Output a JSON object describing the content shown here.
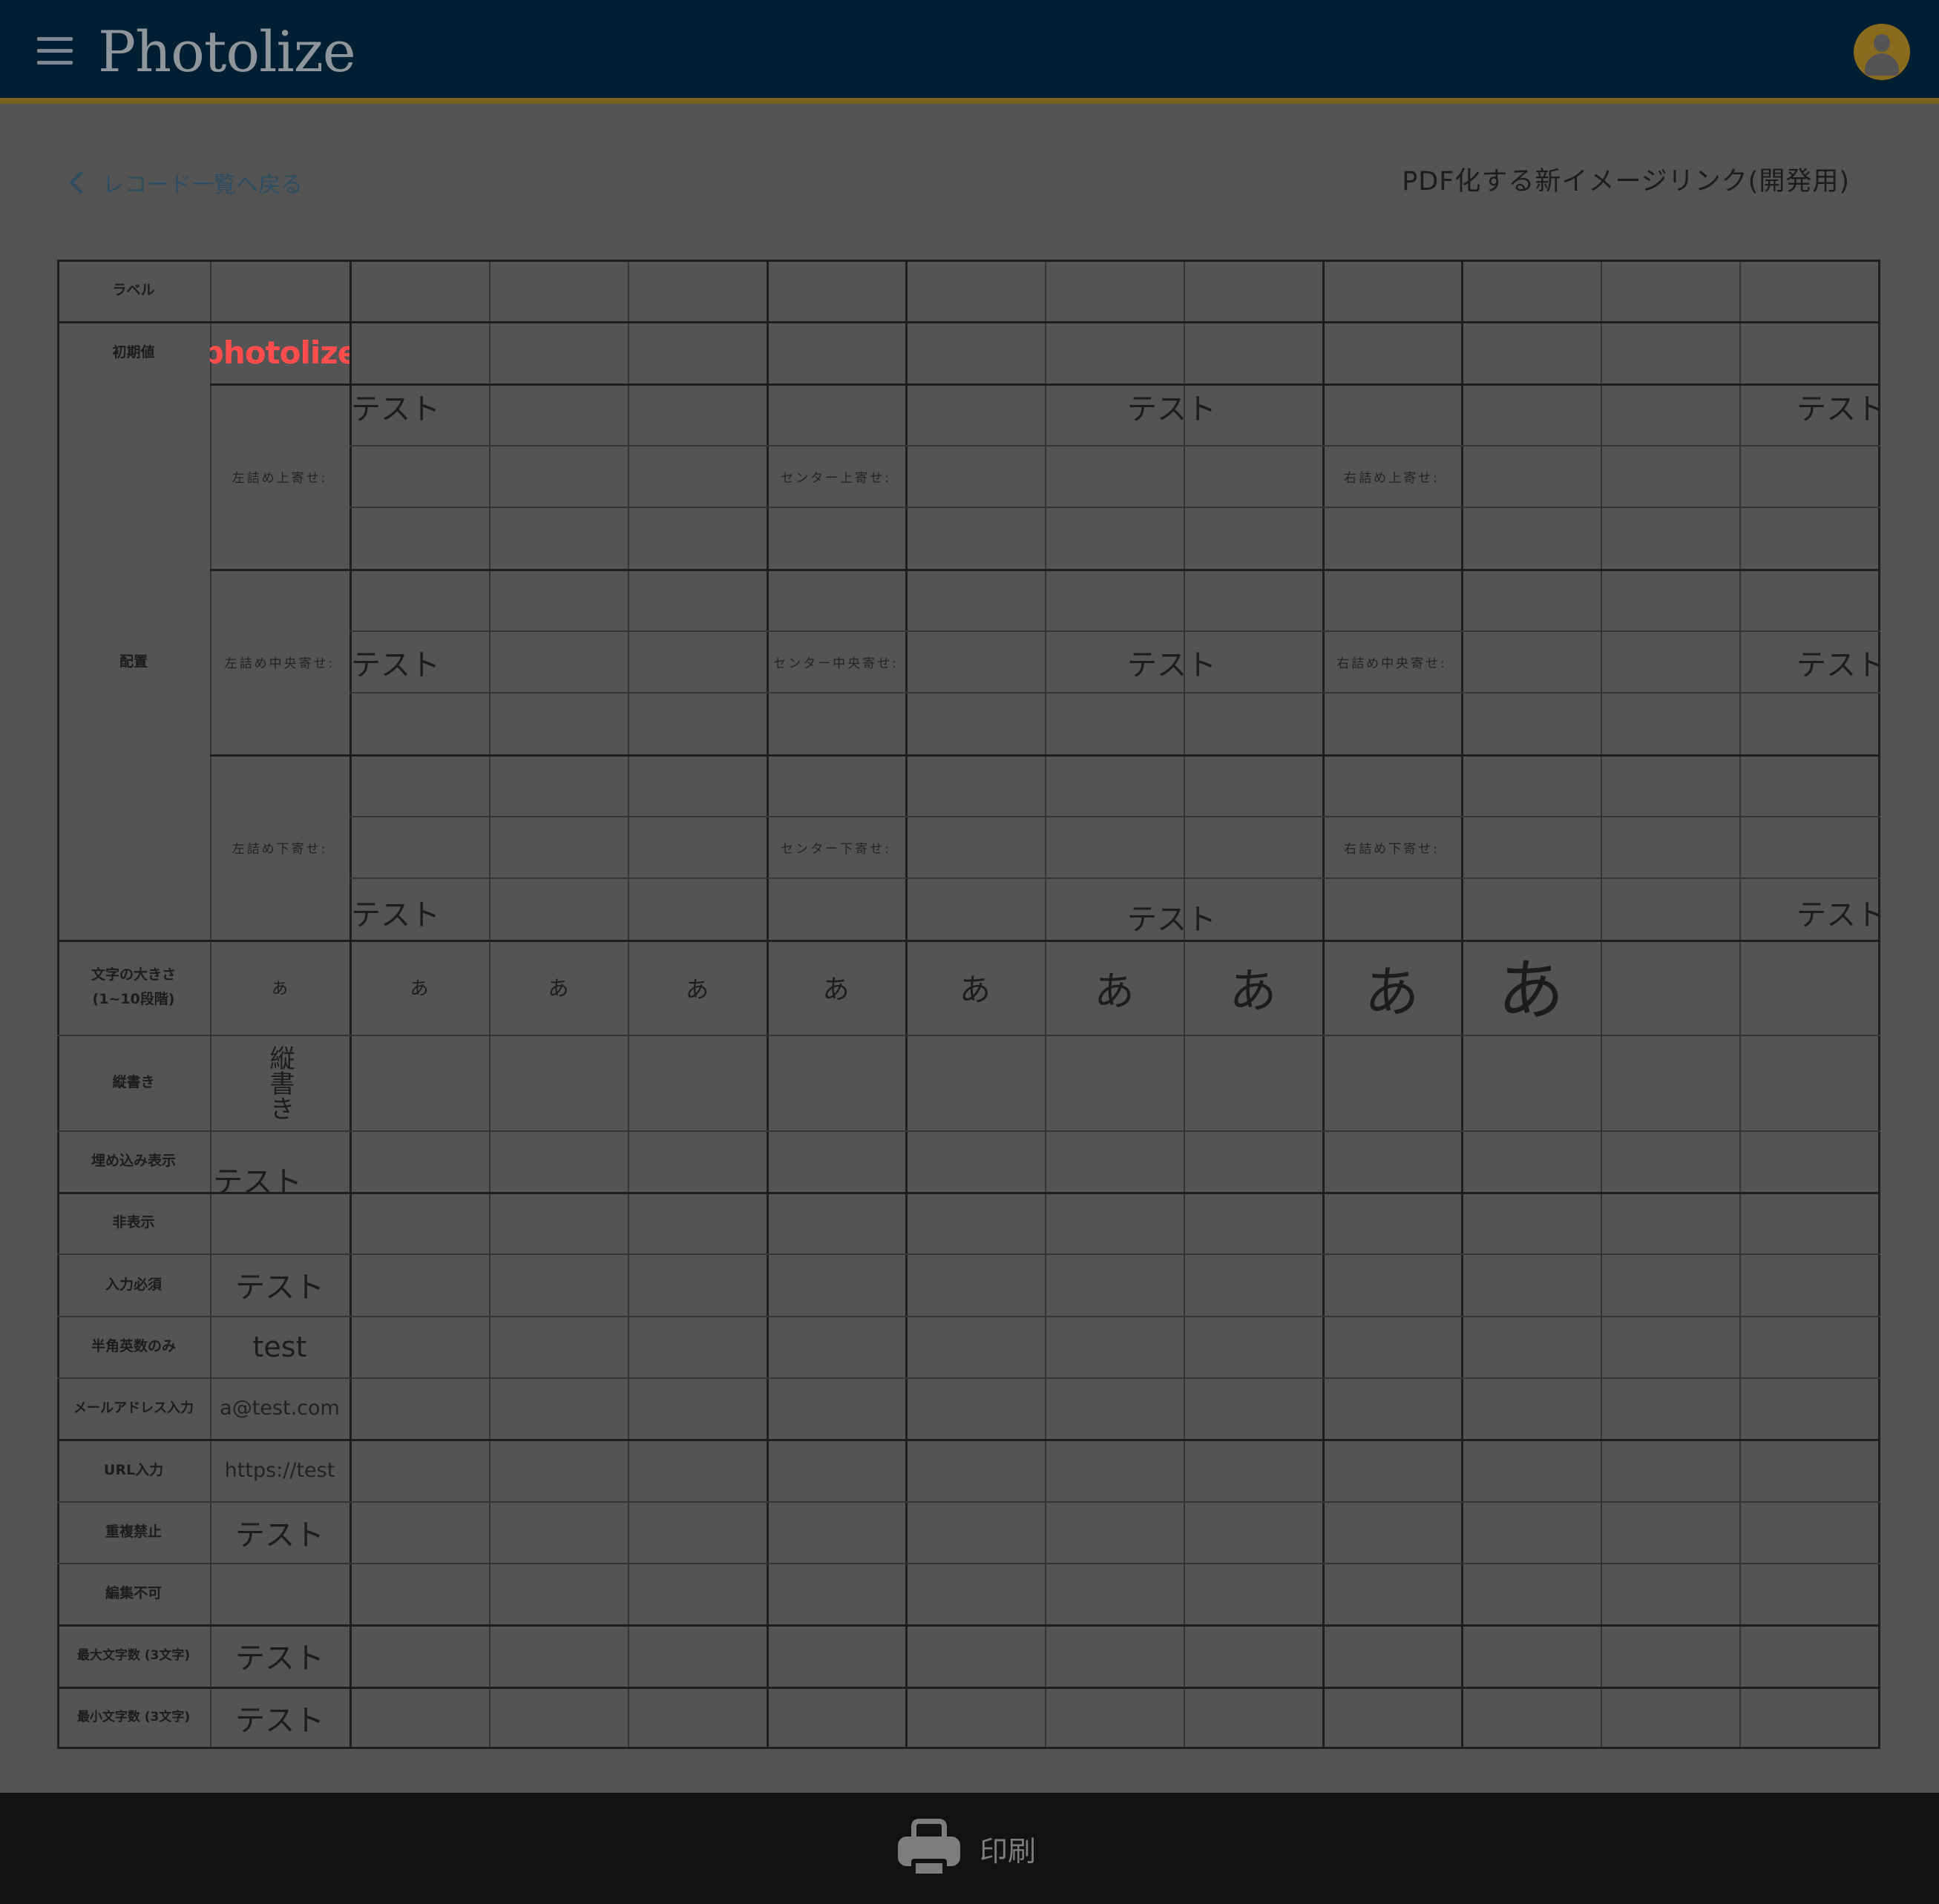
{
  "header": {
    "app_name": "Photolize",
    "menu_icon": "hamburger-icon",
    "avatar_icon": "user-avatar-icon",
    "colors": {
      "bar": "#001f33",
      "accent": "#7a6320",
      "avatar": "#8a6a1c"
    }
  },
  "subbar": {
    "back_label": "レコード一覧へ戻る",
    "back_icon": "chevron-left-icon",
    "title": "PDF化する新イメージリンク(開発用)"
  },
  "grid": {
    "row_labels": {
      "label": "ラベル",
      "initial": "初期値",
      "layout": "配置",
      "font_size": "文字の大きさ\n(1~10段階)",
      "vertical": "縦書き",
      "embed": "埋め込み表示",
      "hidden": "非表示",
      "required": "入力必須",
      "halfwidth": "半角英数のみ",
      "email": "メールアドレス入力",
      "url": "URL入力",
      "no_dup": "重複禁止",
      "no_edit": "編集不可",
      "max_chars": "最大文字数 (3文字)",
      "min_chars": "最小文字数 (3文字)"
    },
    "initial_logo": "photolize",
    "align_labels": {
      "left_top": "左詰め上寄せ:",
      "left_mid": "左詰め中央寄せ:",
      "left_bot": "左詰め下寄せ:",
      "center_top": "センター上寄せ:",
      "center_mid": "センター中央寄せ:",
      "center_bot": "センター下寄せ:",
      "right_top": "右詰め上寄せ:",
      "right_mid": "右詰め中央寄せ:",
      "right_bot": "右詰め下寄せ:"
    },
    "align_text": "テスト",
    "size_char": "あ",
    "vertical_text": "縦書き",
    "embed_text": "テスト",
    "required_value": "テスト",
    "halfwidth_value": "test",
    "email_value": "a@test.com",
    "url_value": "https://test",
    "no_dup_value": "テスト",
    "max_value": "テスト",
    "min_value": "テスト"
  },
  "footer": {
    "print_label": "印刷",
    "print_icon": "printer-icon"
  }
}
